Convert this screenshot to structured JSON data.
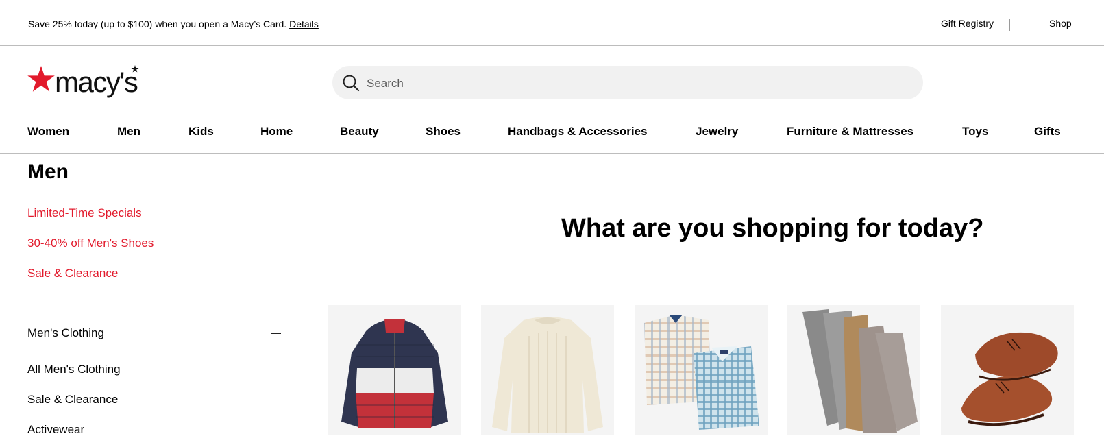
{
  "promo": {
    "text": "Save 25% today (up to $100) when you open a Macy’s Card. ",
    "link": "Details"
  },
  "utility": {
    "gift_registry": "Gift Registry",
    "shop": "Shop"
  },
  "brand": {
    "name": "macy's",
    "color": "#e21a2c"
  },
  "search": {
    "placeholder": "Search"
  },
  "nav": [
    "Women",
    "Men",
    "Kids",
    "Home",
    "Beauty",
    "Shoes",
    "Handbags & Accessories",
    "Jewelry",
    "Furniture & Mattresses",
    "Toys",
    "Gifts"
  ],
  "sidebar": {
    "title": "Men",
    "featured_links": [
      "Limited-Time Specials",
      "30-40% off Men's Shoes",
      "Sale & Clearance"
    ],
    "section": {
      "title": "Men's Clothing",
      "items": [
        "All Men's Clothing",
        "Sale & Clearance",
        "Activewear"
      ]
    }
  },
  "main": {
    "heading": "What are you shopping for today?",
    "tiles": [
      "puffer-jacket",
      "sweater",
      "dress-shirts",
      "pants",
      "dress-shoes"
    ]
  },
  "colors": {
    "accent_red": "#e21a2c",
    "text": "#000000"
  }
}
